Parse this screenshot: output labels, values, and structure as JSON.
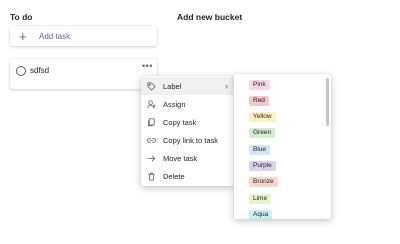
{
  "buckets": {
    "todo_title": "To do",
    "add_bucket_title": "Add new bucket"
  },
  "add_task": {
    "label": "Add task",
    "icon": "plus-icon"
  },
  "task": {
    "title": "sdfsd",
    "more_icon": "more-icon"
  },
  "context_menu": {
    "items": [
      {
        "label": "Label",
        "icon": "tag-icon",
        "has_submenu": true
      },
      {
        "label": "Assign",
        "icon": "assign-user-icon"
      },
      {
        "label": "Copy task",
        "icon": "copy-icon"
      },
      {
        "label": "Copy link to task",
        "icon": "link-icon"
      },
      {
        "label": "Move task",
        "icon": "arrow-right-icon"
      },
      {
        "label": "Delete",
        "icon": "trash-icon"
      }
    ]
  },
  "labels": {
    "items": [
      {
        "label": "Pink",
        "color": "#fbd5e8"
      },
      {
        "label": "Red",
        "color": "#f4c7cb"
      },
      {
        "label": "Yellow",
        "color": "#fdf1c2"
      },
      {
        "label": "Green",
        "color": "#d3ecd0"
      },
      {
        "label": "Blue",
        "color": "#d2e6fa"
      },
      {
        "label": "Purple",
        "color": "#ddd1ef"
      },
      {
        "label": "Bronze",
        "color": "#f6d8c9"
      },
      {
        "label": "Lime",
        "color": "#e4f3cb"
      },
      {
        "label": "Aqua",
        "color": "#c8eef2"
      }
    ]
  },
  "colors": {
    "accent": "#6264a7",
    "text": "#252423",
    "muted": "#605e5c"
  }
}
